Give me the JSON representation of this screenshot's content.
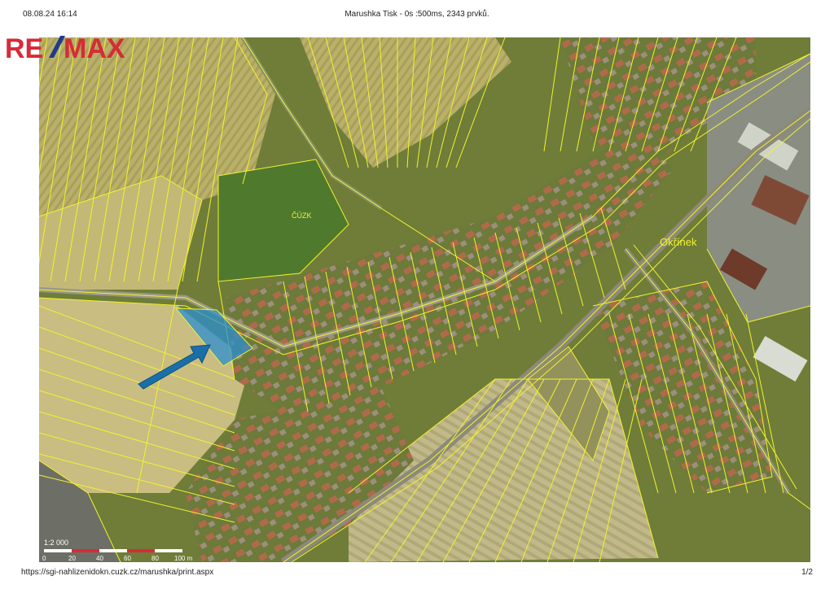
{
  "header": {
    "datetime": "08.08.24 16:14",
    "title": "Marushka Tisk - 0s :500ms, 2343 prvků."
  },
  "logo": {
    "text_left": "RE",
    "text_right": "MAX",
    "colors": {
      "red": "#d62b38",
      "blue": "#1f3b8c"
    }
  },
  "map": {
    "labels": {
      "cuzk": "ČÚZK",
      "town": "Okřínek"
    },
    "scale": {
      "ratio": "1:2 000",
      "ticks": [
        "0",
        "20",
        "40",
        "60",
        "80",
        "100 m"
      ]
    },
    "colors": {
      "parcel_line": "#f2f230",
      "highlight_fill": "#2b8fd0",
      "arrow_fill": "#1a6fa8"
    }
  },
  "footer": {
    "url": "https://sgi-nahlizenidokn.cuzk.cz/marushka/print.aspx",
    "page": "1/2"
  }
}
